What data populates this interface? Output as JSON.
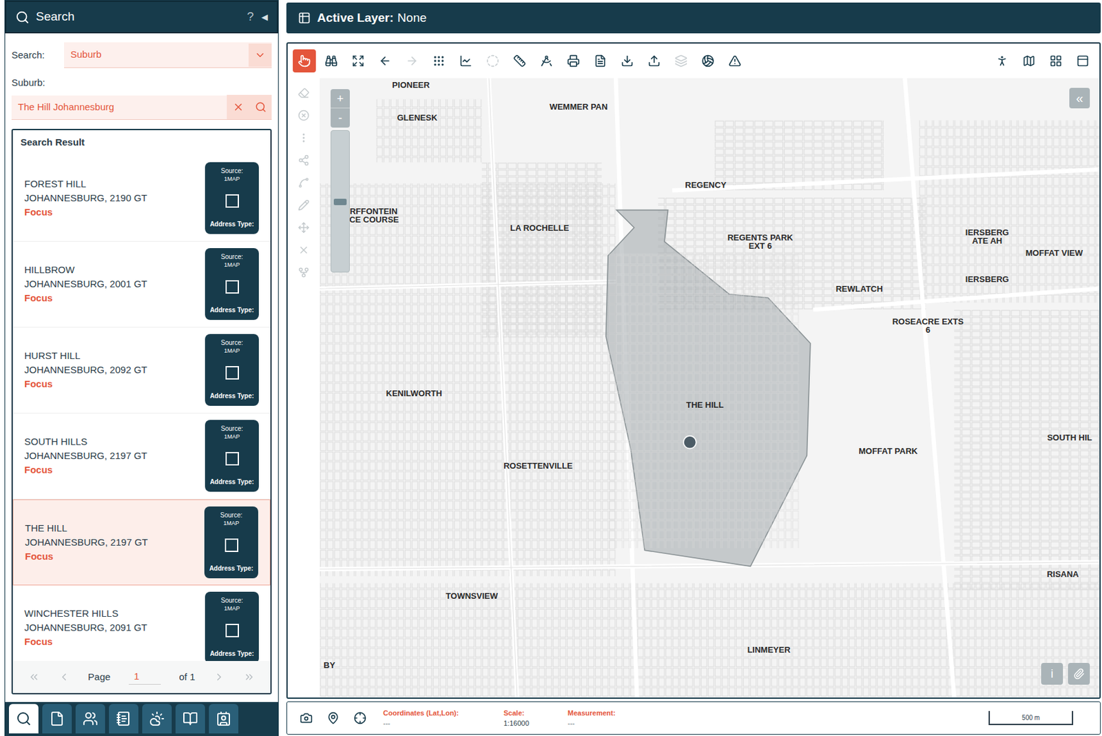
{
  "search_panel": {
    "title": "Search",
    "help": "?",
    "collapse": "◀",
    "search_label": "Search:",
    "search_type": "Suburb",
    "field_label": "Suburb:",
    "field_value": "The Hill Johannesburg"
  },
  "results": {
    "title": "Search Result",
    "items": [
      {
        "name": "FOREST HILL",
        "city": "JOHANNESBURG, 2190 GT",
        "action": "Focus",
        "source_label": "Source:",
        "source": "1MAP",
        "type_label": "Address Type:",
        "checked": false,
        "selected": false
      },
      {
        "name": "HILLBROW",
        "city": "JOHANNESBURG, 2001 GT",
        "action": "Focus",
        "source_label": "Source:",
        "source": "1MAP",
        "type_label": "Address Type:",
        "checked": false,
        "selected": false
      },
      {
        "name": "HURST HILL",
        "city": "JOHANNESBURG, 2092 GT",
        "action": "Focus",
        "source_label": "Source:",
        "source": "1MAP",
        "type_label": "Address Type:",
        "checked": false,
        "selected": false
      },
      {
        "name": "SOUTH HILLS",
        "city": "JOHANNESBURG, 2197 GT",
        "action": "Focus",
        "source_label": "Source:",
        "source": "1MAP",
        "type_label": "Address Type:",
        "checked": false,
        "selected": false
      },
      {
        "name": "THE HILL",
        "city": "JOHANNESBURG, 2197 GT",
        "action": "Focus",
        "source_label": "Source:",
        "source": "1MAP",
        "type_label": "Address Type:",
        "checked": false,
        "selected": true
      },
      {
        "name": "WINCHESTER HILLS",
        "city": "JOHANNESBURG, 2091 GT",
        "action": "Focus",
        "source_label": "Source:",
        "source": "1MAP",
        "type_label": "Address Type:",
        "checked": false,
        "selected": false
      }
    ],
    "pagination": {
      "page_label": "Page",
      "page": "1",
      "of": "of 1"
    }
  },
  "panel_tabs": [
    {
      "selected": true
    },
    {
      "selected": false
    },
    {
      "selected": false
    },
    {
      "selected": false
    },
    {
      "selected": false
    },
    {
      "selected": false
    },
    {
      "selected": false
    }
  ],
  "layer_bar": {
    "label": "Active Layer:",
    "value": "None"
  },
  "toolbar": [
    {
      "selected": true,
      "disabled": false
    },
    {
      "selected": false,
      "disabled": false
    },
    {
      "selected": false,
      "disabled": false
    },
    {
      "selected": false,
      "disabled": false
    },
    {
      "selected": false,
      "disabled": true
    },
    {
      "selected": false,
      "disabled": false
    },
    {
      "selected": false,
      "disabled": false
    },
    {
      "selected": false,
      "disabled": true
    },
    {
      "selected": false,
      "disabled": false
    },
    {
      "selected": false,
      "disabled": false
    },
    {
      "selected": false,
      "disabled": false
    },
    {
      "selected": false,
      "disabled": false
    },
    {
      "selected": false,
      "disabled": false
    },
    {
      "selected": false,
      "disabled": false
    },
    {
      "selected": false,
      "disabled": true
    },
    {
      "selected": false,
      "disabled": false
    },
    {
      "selected": false,
      "disabled": false
    }
  ],
  "map": {
    "zoom_in": "+",
    "zoom_out": "-",
    "collapse": "«",
    "info": "i",
    "labels": [
      {
        "lines": [
          "PIONEER"
        ]
      },
      {
        "lines": [
          "GLENESK"
        ]
      },
      {
        "lines": [
          "WEMMER PAN"
        ]
      },
      {
        "lines": [
          "TURFFONTEIN",
          "RACE COURSE"
        ]
      },
      {
        "lines": [
          "LA ROCHELLE"
        ]
      },
      {
        "lines": [
          "REGENCY"
        ]
      },
      {
        "lines": [
          "REGENTS PARK",
          "EXT 6"
        ]
      },
      {
        "lines": [
          "IERSBERG",
          "ATE AH"
        ]
      },
      {
        "lines": [
          "MOFFAT VIEW"
        ]
      },
      {
        "lines": [
          "IERSBERG"
        ]
      },
      {
        "lines": [
          "REWLATCH"
        ]
      },
      {
        "lines": [
          "ROSEACRE EXTS",
          "6"
        ]
      },
      {
        "lines": [
          "KENILWORTH"
        ]
      },
      {
        "lines": [
          "THE HILL"
        ]
      },
      {
        "lines": [
          "MOFFAT PARK"
        ]
      },
      {
        "lines": [
          "ROSETTENVILLE"
        ]
      },
      {
        "lines": [
          "SOUTH HIL"
        ]
      },
      {
        "lines": [
          "TOWNSVIEW"
        ]
      },
      {
        "lines": [
          "RISANA"
        ]
      },
      {
        "lines": [
          "LINMEYER"
        ]
      },
      {
        "lines": [
          "BY"
        ]
      }
    ]
  },
  "status_bar": {
    "coordinates_label": "Coordinates (Lat,Lon):",
    "coordinates": "---",
    "scale_label": "Scale:",
    "scale": "1:16000",
    "measurement_label": "Measurement:",
    "measurement": "---",
    "scale_bar": "500 m"
  }
}
